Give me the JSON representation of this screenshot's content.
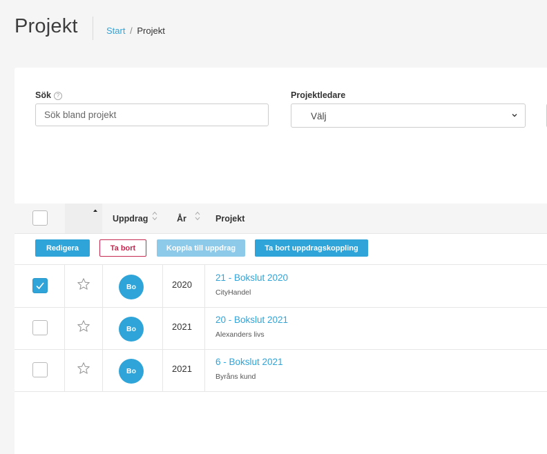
{
  "header": {
    "title": "Projekt",
    "breadcrumb": {
      "home": "Start",
      "separator": "/",
      "current": "Projekt"
    }
  },
  "filters": {
    "search": {
      "label": "Sök",
      "placeholder": "Sök bland projekt",
      "value": ""
    },
    "project_leader": {
      "label": "Projektledare",
      "selected": "Välj"
    }
  },
  "table": {
    "headers": {
      "uppdrag": "Uppdrag",
      "year": "År",
      "project": "Projekt"
    },
    "actions": {
      "edit": "Redigera",
      "delete": "Ta bort",
      "link": "Koppla till uppdrag",
      "unlink": "Ta bort uppdragskoppling"
    },
    "rows": [
      {
        "checked": true,
        "avatar": "Bo",
        "year": "2020",
        "title": "21 - Bokslut 2020",
        "client": "CityHandel"
      },
      {
        "checked": false,
        "avatar": "Bo",
        "year": "2021",
        "title": "20 - Bokslut 2021",
        "client": "Alexanders livs"
      },
      {
        "checked": false,
        "avatar": "Bo",
        "year": "2021",
        "title": "6 - Bokslut 2021",
        "client": "Byråns kund"
      }
    ]
  },
  "icons": {
    "help": "question-circle-icon",
    "chevron": "chevron-down-icon",
    "sort": "sort-icon",
    "star": "star-outline-icon",
    "check": "check-icon"
  },
  "colors": {
    "accent": "#2fa4d8",
    "danger": "#c4284f",
    "disabled": "#8dcaea"
  }
}
